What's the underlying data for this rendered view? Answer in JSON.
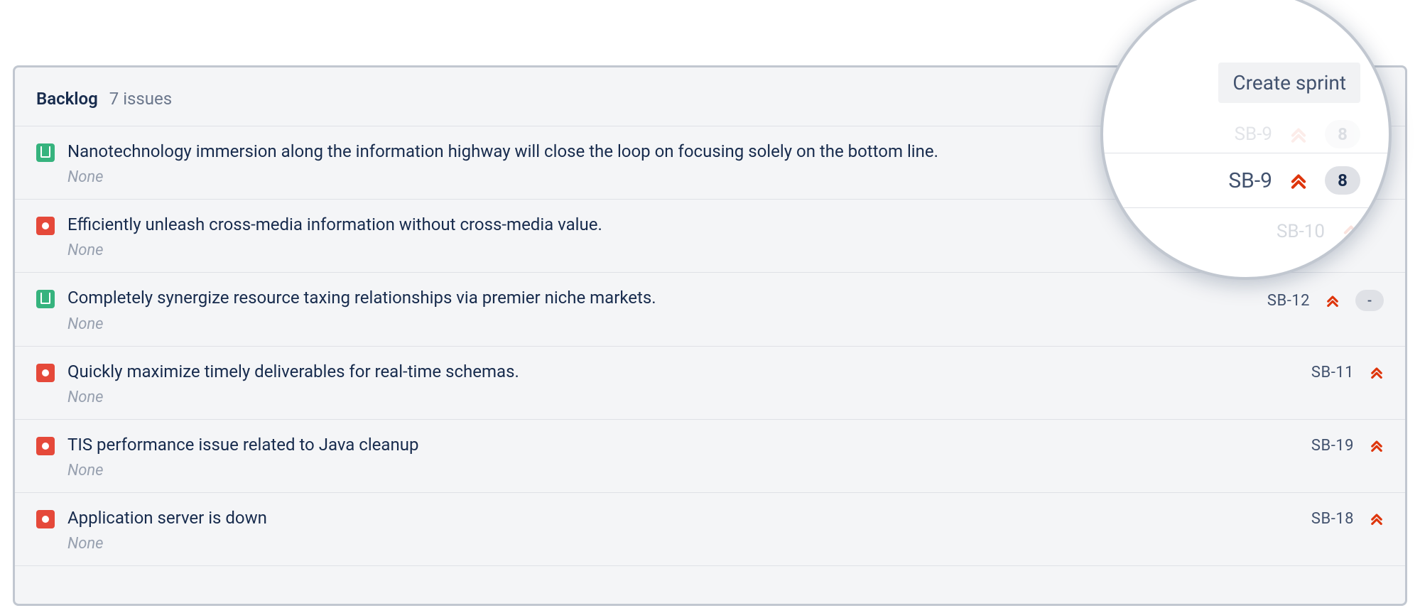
{
  "header": {
    "title": "Backlog",
    "count_label": "7 issues",
    "create_sprint_label": "Create sprint"
  },
  "magnifier": {
    "create_sprint_label": "Create sprint",
    "focus_key": "SB-9",
    "focus_estimate": "8",
    "ghost_above_key": "SB-9",
    "ghost_above_estimate": "8",
    "ghost_below_key": "SB-10"
  },
  "issue_types": {
    "story": "story",
    "bug": "bug"
  },
  "issues": [
    {
      "type": "story",
      "summary": "Nanotechnology immersion along the information highway will close the loop on focusing solely on the bottom line.",
      "epic": "None",
      "key": "",
      "priority": "highest",
      "estimate": ""
    },
    {
      "type": "bug",
      "summary": "Efficiently unleash cross-media information without cross-media value.",
      "epic": "None",
      "key": "",
      "priority": "highest",
      "estimate": ""
    },
    {
      "type": "story",
      "summary": "Completely synergize resource taxing relationships via premier niche markets.",
      "epic": "None",
      "key": "SB-12",
      "priority": "highest",
      "estimate": "-"
    },
    {
      "type": "bug",
      "summary": "Quickly maximize timely deliverables for real-time schemas.",
      "epic": "None",
      "key": "SB-11",
      "priority": "highest",
      "estimate": ""
    },
    {
      "type": "bug",
      "summary": "TIS performance issue related to Java cleanup",
      "epic": "None",
      "key": "SB-19",
      "priority": "highest",
      "estimate": ""
    },
    {
      "type": "bug",
      "summary": "Application server is down",
      "epic": "None",
      "key": "SB-18",
      "priority": "highest",
      "estimate": ""
    }
  ]
}
